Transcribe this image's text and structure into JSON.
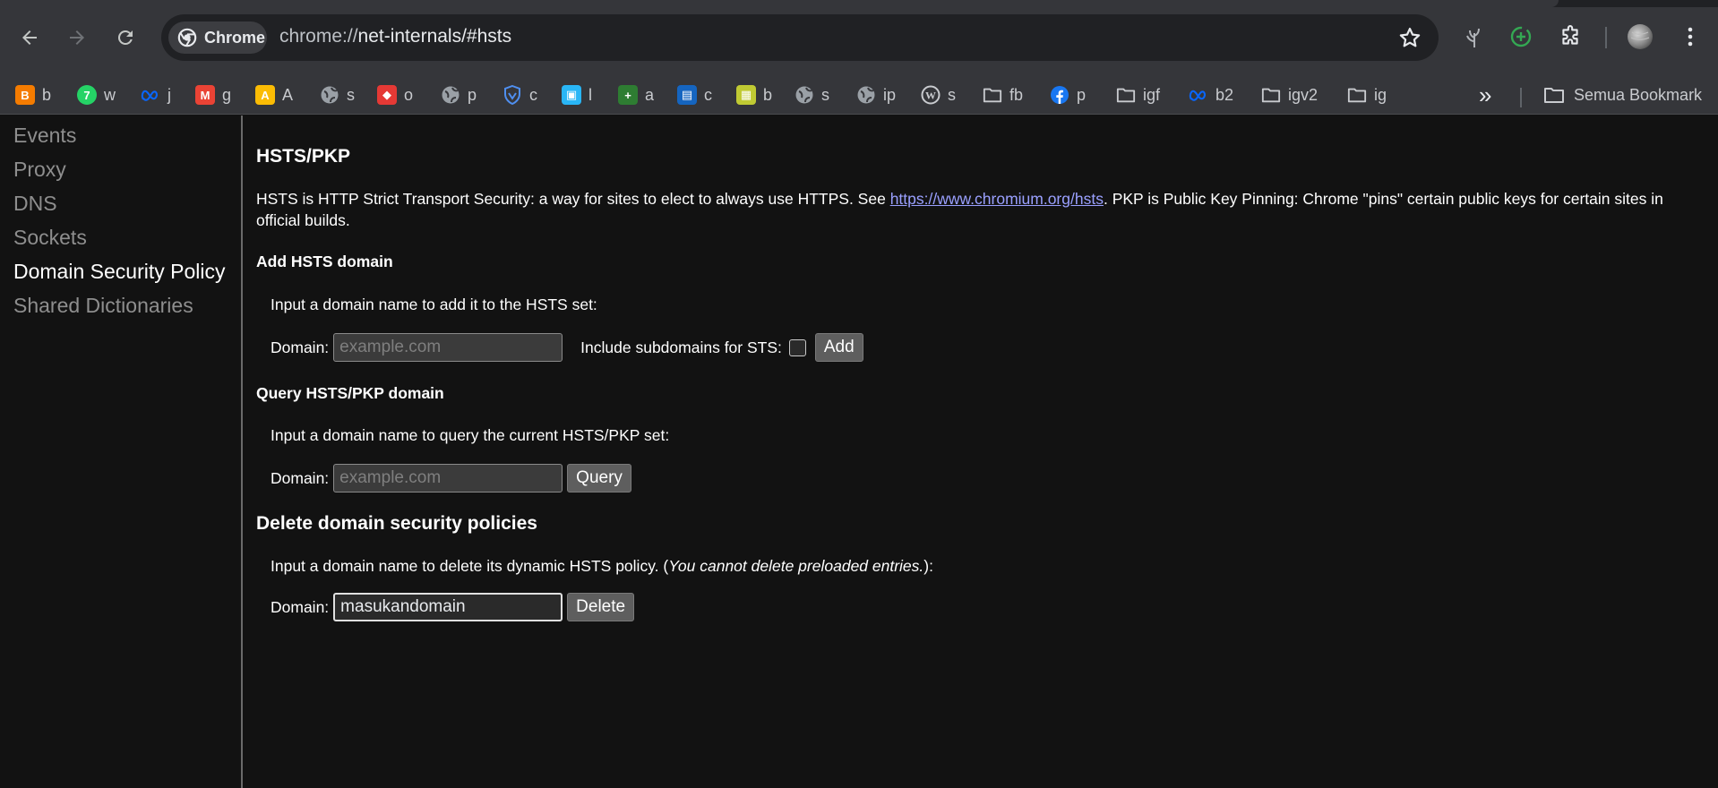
{
  "toolbar": {
    "chip_label": "Chrome",
    "url_scheme": "chrome://",
    "url_rest": "net-internals/#hsts"
  },
  "bookmarks": [
    {
      "label": "b",
      "icon": "blogger-icon",
      "color": "#f57c00"
    },
    {
      "label": "w",
      "icon": "whatsapp-icon",
      "color": "#25d366"
    },
    {
      "label": "j",
      "icon": "meta-icon",
      "color": "#0866ff"
    },
    {
      "label": "g",
      "icon": "gmail-icon",
      "color": "#ea4335"
    },
    {
      "label": "A",
      "icon": "google-ads-icon",
      "color": "#fbbc04"
    },
    {
      "label": "s",
      "icon": "globe-icon",
      "color": "#9aa0a6"
    },
    {
      "label": "o",
      "icon": "cube-icon",
      "color": "#e53935"
    },
    {
      "label": "p",
      "icon": "globe-icon",
      "color": "#9aa0a6"
    },
    {
      "label": "c",
      "icon": "shield-icon",
      "color": "#4f8ff0"
    },
    {
      "label": "l",
      "icon": "squares-icon",
      "color": "#29b6f6"
    },
    {
      "label": "a",
      "icon": "plus-icon",
      "color": "#2e7d32"
    },
    {
      "label": "c",
      "icon": "book-icon",
      "color": "#1565c0"
    },
    {
      "label": "b",
      "icon": "cards-icon",
      "color": "#c0ca33"
    },
    {
      "label": "s",
      "icon": "globe-icon",
      "color": "#9aa0a6"
    },
    {
      "label": "ip",
      "icon": "globe-icon",
      "color": "#9aa0a6"
    },
    {
      "label": "s",
      "icon": "wordpress-icon",
      "color": "#c9cbcf"
    },
    {
      "label": "fb",
      "icon": "folder-icon",
      "color": "#c9cbcf"
    },
    {
      "label": "p",
      "icon": "facebook-icon",
      "color": "#1877f2"
    },
    {
      "label": "igf",
      "icon": "folder-icon",
      "color": "#c9cbcf"
    },
    {
      "label": "b2",
      "icon": "meta-icon",
      "color": "#0866ff"
    },
    {
      "label": "igv2",
      "icon": "folder-icon",
      "color": "#c9cbcf"
    },
    {
      "label": "ig",
      "icon": "folder-icon",
      "color": "#c9cbcf"
    }
  ],
  "bookmarks_overflow_label": "»",
  "all_bookmarks_label": "Semua Bookmark",
  "sidebar": {
    "items": [
      {
        "label": "Events"
      },
      {
        "label": "Proxy"
      },
      {
        "label": "DNS"
      },
      {
        "label": "Sockets"
      },
      {
        "label": "Domain Security Policy",
        "selected": true
      },
      {
        "label": "Shared Dictionaries"
      }
    ]
  },
  "main": {
    "title": "HSTS/PKP",
    "desc_before": "HSTS is HTTP Strict Transport Security: a way for sites to elect to always use HTTPS. See ",
    "desc_link": "https://www.chromium.org/hsts",
    "desc_after": ". PKP is Public Key Pinning: Chrome \"pins\" certain public keys for certain sites in official builds.",
    "add": {
      "heading": "Add HSTS domain",
      "instruction": "Input a domain name to add it to the HSTS set:",
      "domain_label": "Domain:",
      "placeholder": "example.com",
      "include_label": "Include subdomains for STS:",
      "button": "Add"
    },
    "query": {
      "heading": "Query HSTS/PKP domain",
      "instruction": "Input a domain name to query the current HSTS/PKP set:",
      "domain_label": "Domain:",
      "placeholder": "example.com",
      "button": "Query"
    },
    "delete": {
      "heading": "Delete domain security policies",
      "instruction_before": "Input a domain name to delete its dynamic HSTS policy. (",
      "instruction_italic": "You cannot delete preloaded entries.",
      "instruction_after": "):",
      "domain_label": "Domain:",
      "value": "masukandomain",
      "button": "Delete"
    }
  }
}
